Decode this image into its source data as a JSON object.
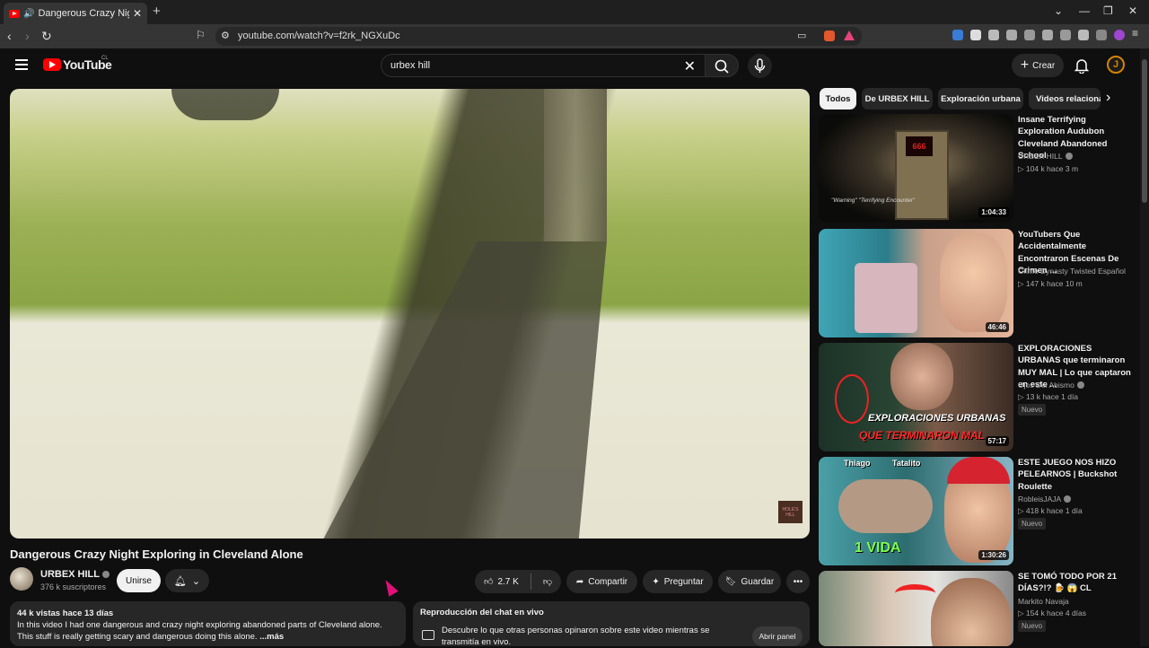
{
  "browser": {
    "tab_title": "Dangerous Crazy Night Explo",
    "url": "youtube.com/watch?v=f2rk_NGXuDc"
  },
  "header": {
    "logo_text": "YouTube",
    "country_code": "CL",
    "search_value": "urbex hill",
    "create_label": "Crear",
    "avatar_letter": "J"
  },
  "video": {
    "title": "Dangerous Crazy Night Exploring in Cleveland Alone",
    "channel": "URBEX HILL",
    "subscribers": "376 k suscriptores",
    "join_label": "Unirse",
    "likes": "2.7 K",
    "share_label": "Compartir",
    "ask_label": "Preguntar",
    "save_label": "Guardar",
    "watermark": "HOLE'S HILL"
  },
  "description": {
    "meta": "44 k vistas  hace 13 días",
    "text": "In this video I had one dangerous and crazy night exploring abandoned parts of Cleveland alone. This stuff is really getting scary and dangerous doing this alone.",
    "more": "...más"
  },
  "chat": {
    "heading": "Reproducción del chat en vivo",
    "text": "Descubre lo que otras personas opinaron sobre este video mientras se transmitía en vivo.",
    "button": "Abrir panel"
  },
  "chips": [
    "Todos",
    "De URBEX HILL",
    "Exploración urbana",
    "Videos relacionados"
  ],
  "recommendations": [
    {
      "title": "Insane Terrifying Exploration Audubon Cleveland Abandoned School",
      "channel": "URBEX HILL",
      "verified": true,
      "stats": "104 k  hace 3 m",
      "duration": "1:04:33",
      "badge": "",
      "thumb_text": "\"Warning\" \"Terrifying Encounter\"",
      "sign_text": "666"
    },
    {
      "title": "YouTubers Que Accidentalmente Encontraron Escenas De Crimen ...",
      "channel": "Crime Dynasty Twisted Español",
      "verified": false,
      "stats": "147 k  hace 10 m",
      "duration": "46:46",
      "badge": ""
    },
    {
      "title": "EXPLORACIONES URBANAS que terminaron MUY MAL | Lo que captaron en este ...",
      "channel": "Ojos Del Abismo",
      "verified": true,
      "stats": "13 k  hace 1 día",
      "duration": "57:17",
      "badge": "Nuevo",
      "thumb_line1": "EXPLORACIONES URBANAS",
      "thumb_line2": "QUE TERMINARON MAL"
    },
    {
      "title": "ESTE JUEGO NOS HIZO PELEARNOS | Buckshot Roulette",
      "channel": "RobleisJAJA",
      "verified": true,
      "stats": "418 k  hace 1 día",
      "duration": "1:30:26",
      "badge": "Nuevo",
      "thumb_name1": "Thiago",
      "thumb_name2": "Tatalito",
      "thumb_text": "1 VIDA"
    },
    {
      "title": "SE TOMÓ TODO POR 21 DÍAS?!? 🍺 😱 CL",
      "channel": "Markito Navaja",
      "verified": false,
      "stats": "154 k  hace 4 días",
      "duration": "",
      "badge": "Nuevo"
    }
  ]
}
